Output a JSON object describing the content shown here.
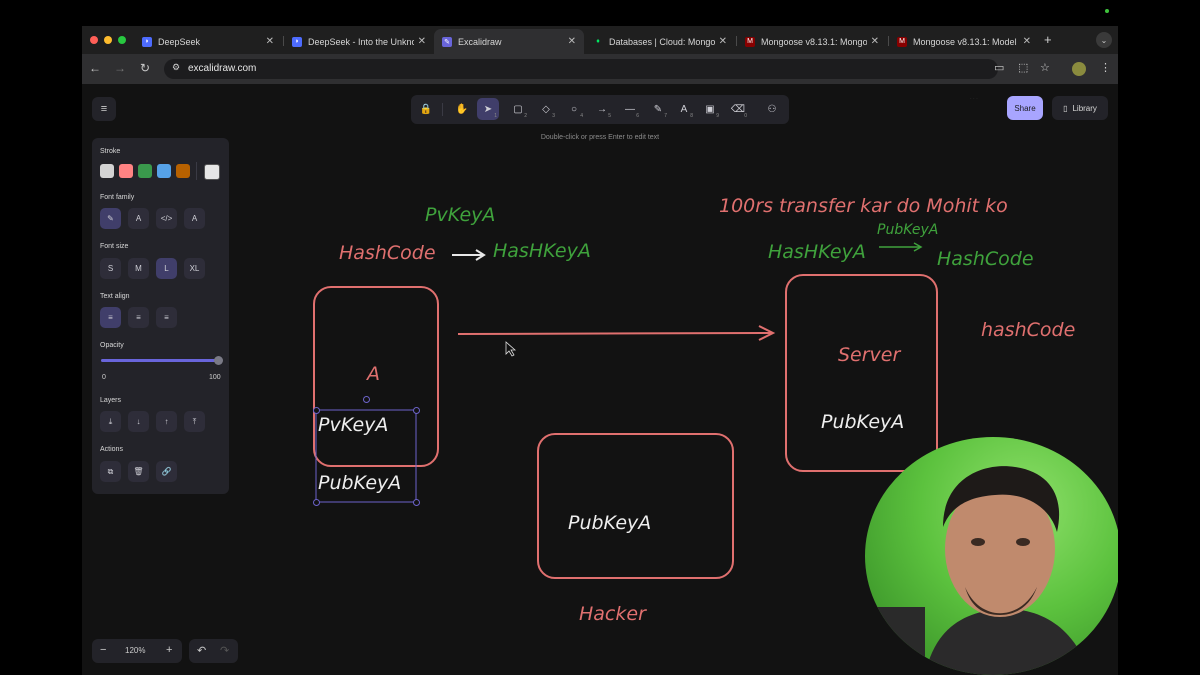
{
  "browser": {
    "tabs": [
      {
        "title": "DeepSeek",
        "icon": "deepseek-icon",
        "active": false
      },
      {
        "title": "DeepSeek - Into the Unkno",
        "icon": "deepseek-icon",
        "active": false
      },
      {
        "title": "Excalidraw",
        "icon": "excalidraw-icon",
        "active": true
      },
      {
        "title": "Databases | Cloud: Mongo",
        "icon": "mongodb-leaf-icon",
        "active": false
      },
      {
        "title": "Mongoose v8.13.1: Mongo",
        "icon": "mongoose-icon",
        "active": false
      },
      {
        "title": "Mongoose v8.13.1: Model",
        "icon": "mongoose-icon",
        "active": false
      }
    ],
    "new_tab": "+",
    "url": "excalidraw.com"
  },
  "toolbar": {
    "tools": [
      {
        "name": "lock-tool",
        "icon": "lock-icon",
        "glyph": "🔒",
        "key": "",
        "active": false
      },
      {
        "name": "hand-tool",
        "icon": "hand-icon",
        "glyph": "✋",
        "key": "",
        "active": false
      },
      {
        "name": "selection-tool",
        "icon": "pointer-icon",
        "glyph": "➤",
        "key": "1",
        "active": true
      },
      {
        "name": "rectangle-tool",
        "icon": "rectangle-icon",
        "glyph": "▢",
        "key": "2",
        "active": false
      },
      {
        "name": "diamond-tool",
        "icon": "diamond-icon",
        "glyph": "◇",
        "key": "3",
        "active": false
      },
      {
        "name": "ellipse-tool",
        "icon": "ellipse-icon",
        "glyph": "○",
        "key": "4",
        "active": false
      },
      {
        "name": "arrow-tool",
        "icon": "arrow-icon",
        "glyph": "→",
        "key": "5",
        "active": false
      },
      {
        "name": "line-tool",
        "icon": "line-icon",
        "glyph": "—",
        "key": "6",
        "active": false
      },
      {
        "name": "draw-tool",
        "icon": "pencil-icon",
        "glyph": "✎",
        "key": "7",
        "active": false
      },
      {
        "name": "text-tool",
        "icon": "text-icon",
        "glyph": "A",
        "key": "8",
        "active": false
      },
      {
        "name": "image-tool",
        "icon": "image-icon",
        "glyph": "▣",
        "key": "9",
        "active": false
      },
      {
        "name": "eraser-tool",
        "icon": "eraser-icon",
        "glyph": "⌫",
        "key": "0",
        "active": false
      },
      {
        "name": "extra-tools",
        "icon": "shapes-icon",
        "glyph": "⚇",
        "key": "",
        "active": false
      }
    ],
    "hint": "Double-click or press Enter to edit text",
    "share_label": "Share",
    "library_label": "Library"
  },
  "properties": {
    "stroke_label": "Stroke",
    "stroke_colors": [
      "#d3d3d3",
      "#ff8383",
      "#3a994c",
      "#56a2e8",
      "#b76100"
    ],
    "current_color": "#e6e6e6",
    "font_family_label": "Font family",
    "font_family_options": [
      {
        "name": "hand-drawn",
        "glyph": "✎",
        "active": true
      },
      {
        "name": "normal",
        "glyph": "A",
        "active": false
      },
      {
        "name": "code",
        "glyph": "</>",
        "active": false
      },
      {
        "name": "more",
        "glyph": "A",
        "active": false
      }
    ],
    "font_size_label": "Font size",
    "font_sizes": [
      {
        "label": "S",
        "active": false
      },
      {
        "label": "M",
        "active": false
      },
      {
        "label": "L",
        "active": true
      },
      {
        "label": "XL",
        "active": false
      }
    ],
    "text_align_label": "Text align",
    "text_align_options": [
      {
        "name": "align-left",
        "glyph": "≡",
        "active": true
      },
      {
        "name": "align-center",
        "glyph": "≡",
        "active": false
      },
      {
        "name": "align-right",
        "glyph": "≡",
        "active": false
      }
    ],
    "opacity_label": "Opacity",
    "opacity_min": "0",
    "opacity_max": "100",
    "opacity_value": 100,
    "layers_label": "Layers",
    "layer_buttons": [
      {
        "name": "send-to-back",
        "glyph": "⤓"
      },
      {
        "name": "send-backward",
        "glyph": "↓"
      },
      {
        "name": "bring-forward",
        "glyph": "↑"
      },
      {
        "name": "bring-to-front",
        "glyph": "⤒"
      }
    ],
    "actions_label": "Actions",
    "action_buttons": [
      {
        "name": "duplicate",
        "glyph": "⧉"
      },
      {
        "name": "delete",
        "glyph": "🗑"
      },
      {
        "name": "link",
        "glyph": "🔗"
      }
    ]
  },
  "zoom": {
    "minus": "−",
    "value": "120%",
    "plus": "+"
  },
  "history": {
    "undo": "↶",
    "redo": "↷"
  },
  "drawing": {
    "pvkey_top": "PvKeyA",
    "hashcode_left": "HashCode",
    "hashkey_left": "HasHKeyA",
    "transfer_text": "100rs transfer kar do Mohit ko",
    "pubkey_small": "PubKeyA",
    "hashkey_right": "HasHKeyA",
    "hashcode_right": "HashCode",
    "hashcode_far": "hashCode",
    "box_a_label": "A",
    "pvkey_box": "PvKeyA",
    "pubkey_box": "PubKeyA",
    "server_label": "Server",
    "server_pubkey": "PubKeyA",
    "hacker_pubkey": "PubKeyA",
    "hacker_label": "Hacker"
  },
  "colors": {
    "green": "#3fa23c",
    "red": "#e0706f",
    "white": "#eeeeee",
    "accent": "#a8a5ff"
  }
}
